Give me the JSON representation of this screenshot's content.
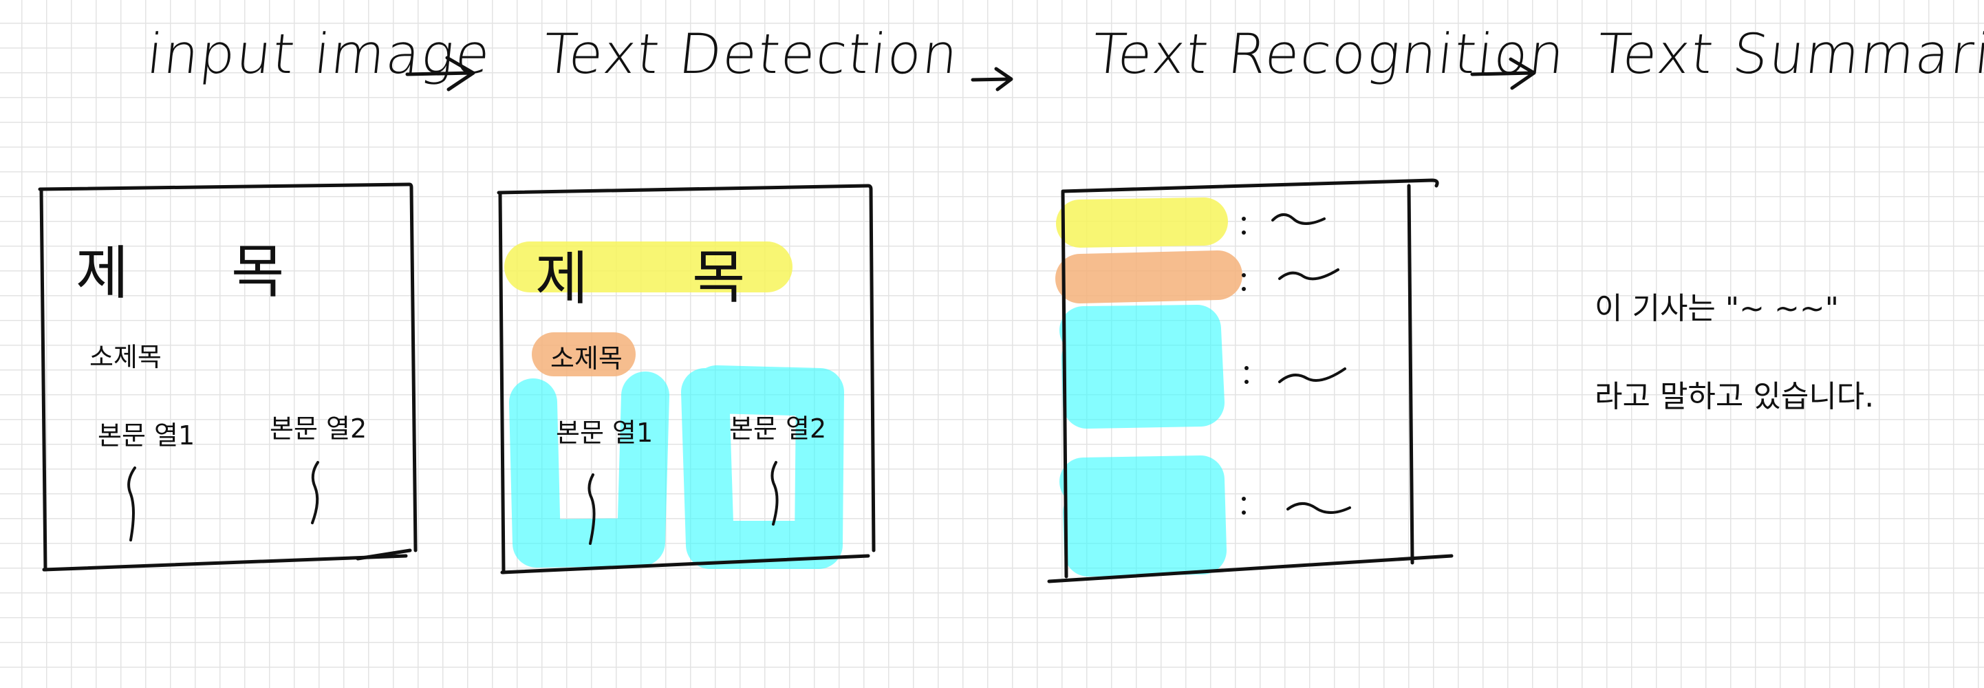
{
  "stages": {
    "input": "input image",
    "detection": "Text Detection",
    "recognition": "Text Recognition",
    "summarization": "Text Summarization"
  },
  "page1": {
    "title_left": "제",
    "title_right": "목",
    "subtitle": "소제목",
    "col1": "본문 열1",
    "col2": "본문 열2"
  },
  "page2": {
    "title_left": "제",
    "title_right": "목",
    "subtitle": "소제목",
    "col1": "본문 열1",
    "col2": "본문 열2"
  },
  "summary": {
    "line1": "이 기사는 \"~ ~~\"",
    "line2": "라고 말하고 있습니다."
  },
  "colors": {
    "yellow": "#f7f45a",
    "orange": "#f5b27a",
    "cyan": "#33fbff",
    "ink": "#111111",
    "grid": "#e3e3e3"
  },
  "icons": [
    "right-arrow-icon",
    "tilde-line-icon"
  ]
}
